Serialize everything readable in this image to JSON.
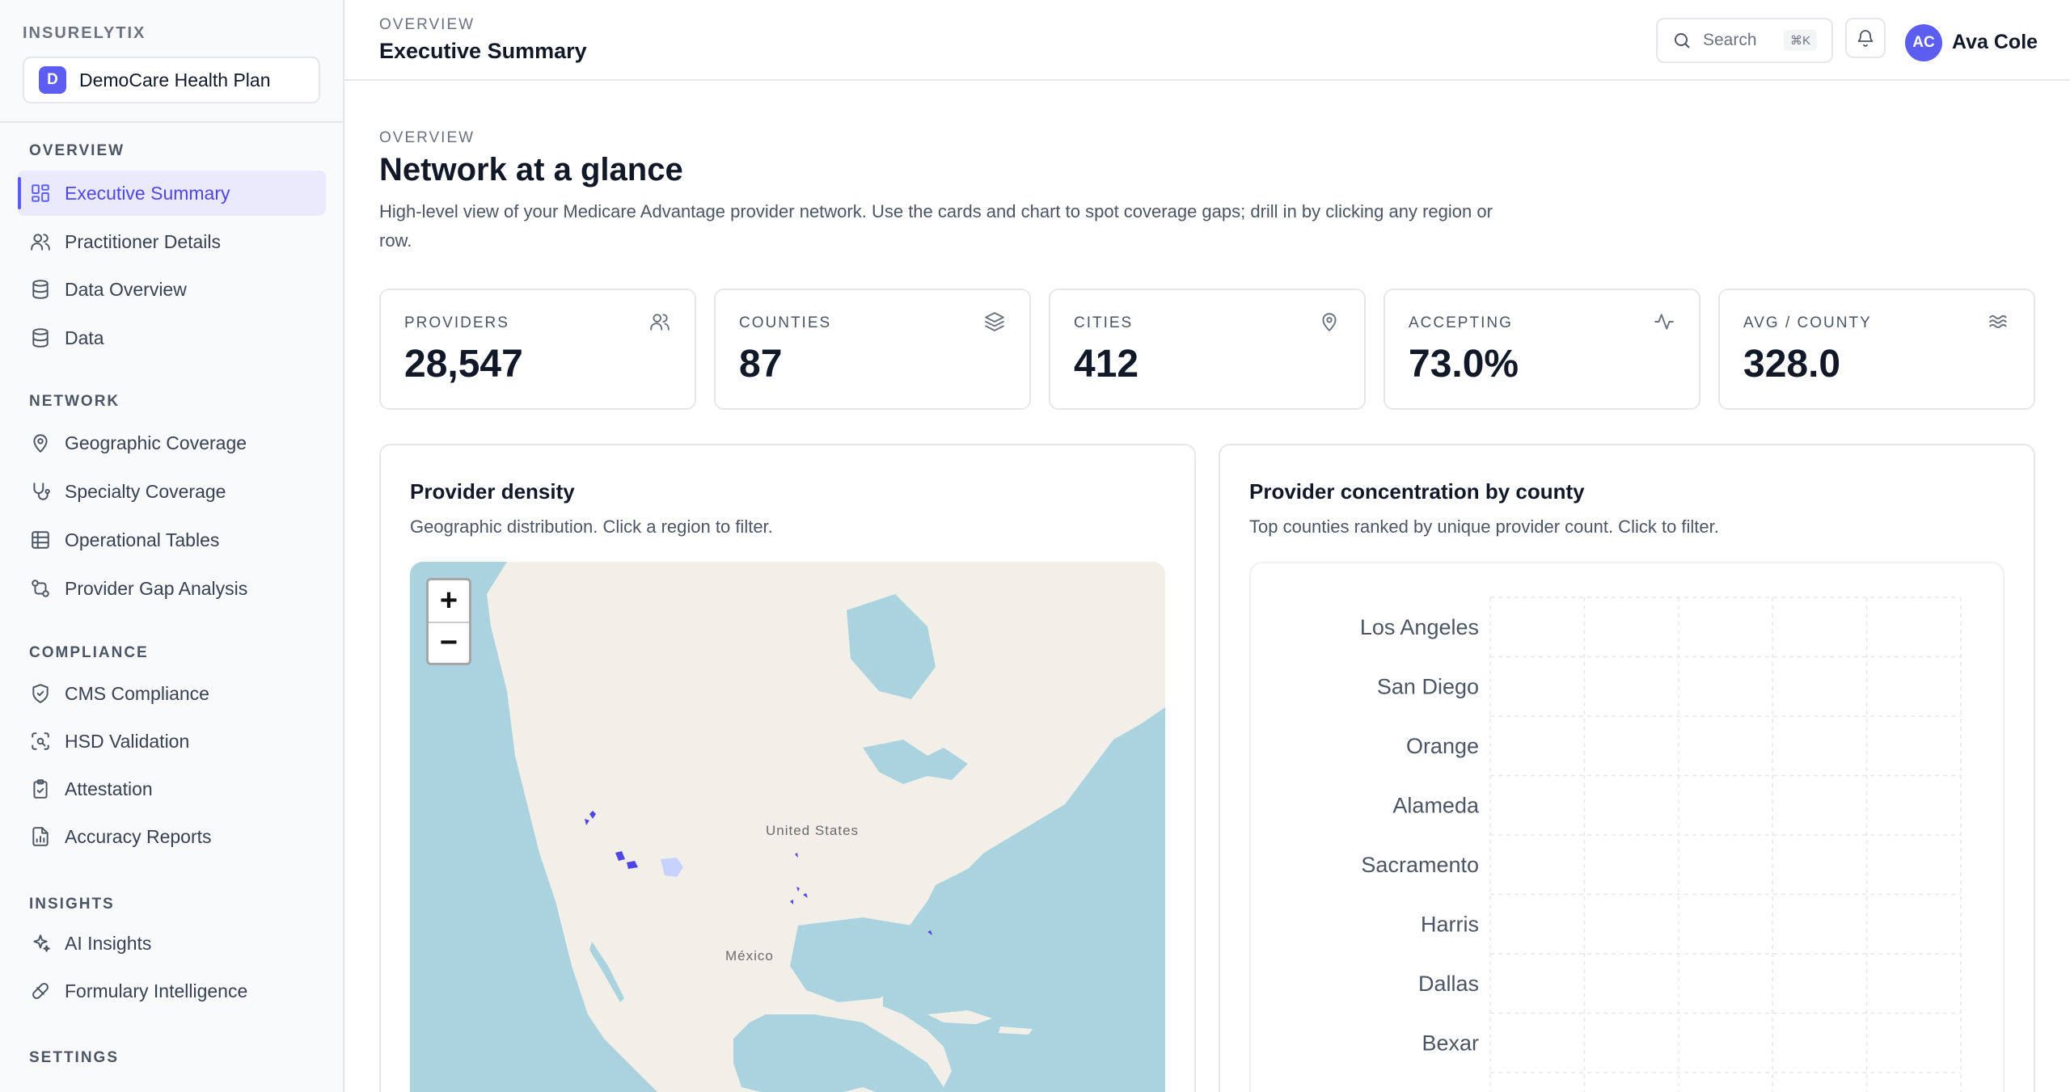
{
  "brand": "INSURELYTIX",
  "org": {
    "badge": "D",
    "name": "DemoCare Health Plan"
  },
  "sidebar": {
    "sections": [
      {
        "title": "OVERVIEW",
        "items": [
          {
            "label": "Executive Summary",
            "icon": "grid-icon",
            "active": true
          },
          {
            "label": "Practitioner Details",
            "icon": "users-icon"
          },
          {
            "label": "Data Overview",
            "icon": "database-icon"
          },
          {
            "label": "Data",
            "icon": "database-icon"
          }
        ]
      },
      {
        "title": "NETWORK",
        "items": [
          {
            "label": "Geographic Coverage",
            "icon": "map-pin-icon"
          },
          {
            "label": "Specialty Coverage",
            "icon": "stethoscope-icon"
          },
          {
            "label": "Operational Tables",
            "icon": "table-icon"
          },
          {
            "label": "Provider Gap Analysis",
            "icon": "git-compare-icon"
          }
        ]
      },
      {
        "title": "COMPLIANCE",
        "items": [
          {
            "label": "CMS Compliance",
            "icon": "shield-check-icon"
          },
          {
            "label": "HSD Validation",
            "icon": "scan-search-icon"
          },
          {
            "label": "Attestation",
            "icon": "clipboard-check-icon"
          },
          {
            "label": "Accuracy Reports",
            "icon": "file-chart-icon"
          }
        ]
      },
      {
        "title": "INSIGHTS",
        "items": [
          {
            "label": "AI Insights",
            "icon": "sparkles-icon"
          },
          {
            "label": "Formulary Intelligence",
            "icon": "pill-icon"
          }
        ]
      },
      {
        "title": "SETTINGS",
        "items": []
      }
    ]
  },
  "header": {
    "eyebrow": "OVERVIEW",
    "title": "Executive Summary",
    "search_placeholder": "Search",
    "search_shortcut": "⌘K",
    "user_initials": "AC",
    "user_name": "Ava Cole"
  },
  "page": {
    "eyebrow": "OVERVIEW",
    "title": "Network at a glance",
    "description": "High-level view of your Medicare Advantage provider network. Use the cards and chart to spot coverage gaps; drill in by clicking any region or row."
  },
  "kpis": [
    {
      "label": "PROVIDERS",
      "value": "28,547",
      "icon": "users-icon"
    },
    {
      "label": "COUNTIES",
      "value": "87",
      "icon": "layers-icon"
    },
    {
      "label": "CITIES",
      "value": "412",
      "icon": "map-pin-icon"
    },
    {
      "label": "ACCEPTING",
      "value": "73.0%",
      "icon": "activity-icon"
    },
    {
      "label": "AVG / COUNTY",
      "value": "328.0",
      "icon": "waves-icon"
    }
  ],
  "density_card": {
    "title": "Provider density",
    "subtitle": "Geographic distribution. Click a region to filter.",
    "zoom_in": "+",
    "zoom_out": "−",
    "map_labels": [
      "United States",
      "México"
    ],
    "colors": {
      "water": "#aad3df",
      "land": "#f2efe9",
      "highlight": "#4f46e5"
    }
  },
  "concentration_card": {
    "title": "Provider concentration by county",
    "subtitle": "Top counties ranked by unique provider count. Click to filter."
  },
  "chart_data": {
    "type": "bar",
    "orientation": "horizontal",
    "categories": [
      "Los Angeles",
      "San Diego",
      "Orange",
      "Alameda",
      "Sacramento",
      "Harris",
      "Dallas",
      "Bexar"
    ],
    "grid": true
  }
}
